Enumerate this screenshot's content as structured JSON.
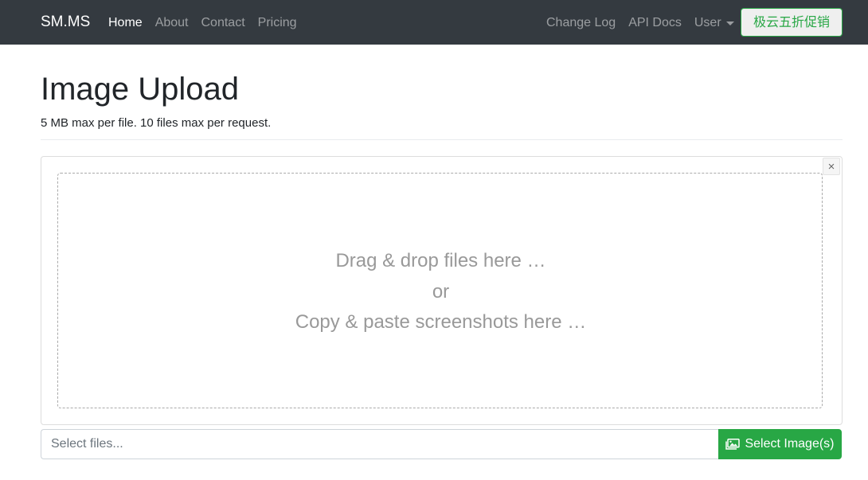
{
  "navbar": {
    "brand": "SM.MS",
    "left_links": [
      {
        "label": "Home",
        "active": true
      },
      {
        "label": "About"
      },
      {
        "label": "Contact"
      },
      {
        "label": "Pricing"
      }
    ],
    "right_links": [
      {
        "label": "Change Log"
      },
      {
        "label": "API Docs"
      }
    ],
    "user_dropdown": {
      "label": "User",
      "icon": "caret-down-icon"
    },
    "promo_button": "极云五折促销"
  },
  "header": {
    "title": "Image Upload",
    "subtitle": "5 MB max per file. 10 files max per request."
  },
  "upload": {
    "close_label": "×",
    "drop_line_1": "Drag & drop files here …",
    "drop_line_2": "or",
    "drop_line_3": "Copy & paste screenshots here …",
    "input_placeholder": "Select files...",
    "select_button": "Select Image(s)",
    "select_icon": "images-icon"
  },
  "colors": {
    "navbar_bg": "#343a40",
    "accent_green": "#28a745"
  }
}
